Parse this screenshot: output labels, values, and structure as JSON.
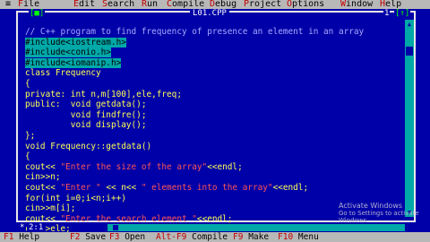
{
  "menu": {
    "system": "≡",
    "items": [
      {
        "label": "File",
        "hotkey": "F",
        "rest": "ile"
      },
      {
        "label": "Edit",
        "hotkey": "E",
        "rest": "dit"
      },
      {
        "label": "Search",
        "hotkey": "S",
        "rest": "earch"
      },
      {
        "label": "Run",
        "hotkey": "R",
        "rest": "un"
      },
      {
        "label": "Compile",
        "hotkey": "C",
        "rest": "ompile"
      },
      {
        "label": "Debug",
        "hotkey": "D",
        "rest": "ebug"
      },
      {
        "label": "Project",
        "hotkey": "P",
        "rest": "roject"
      },
      {
        "label": "Options",
        "hotkey": "O",
        "rest": "ptions"
      },
      {
        "label": "Window",
        "hotkey": "W",
        "rest": "indow"
      },
      {
        "label": "Help",
        "hotkey": "H",
        "rest": "elp"
      }
    ]
  },
  "window": {
    "title": "L01.CPP",
    "close_btn": "[■]",
    "number": "1",
    "zoom_btn": "[↑]"
  },
  "code_lines": [
    {
      "segments": [
        {
          "text": "// C++ program to find frequency of presence an element in an array",
          "cls": "cmt"
        }
      ]
    },
    {
      "segments": [
        {
          "text": "#include<iostream.h>",
          "cls": "hl"
        }
      ]
    },
    {
      "segments": [
        {
          "text": "#include<conio.h>",
          "cls": "hl"
        }
      ]
    },
    {
      "segments": [
        {
          "text": "#include<iomanip.h>",
          "cls": "hl"
        }
      ]
    },
    {
      "segments": [
        {
          "text": "class Frequency",
          "cls": ""
        }
      ]
    },
    {
      "segments": [
        {
          "text": "{",
          "cls": ""
        }
      ]
    },
    {
      "segments": [
        {
          "text": "private: int n,m[100],ele,freq;",
          "cls": ""
        }
      ]
    },
    {
      "segments": [
        {
          "text": "public:  void getdata();",
          "cls": ""
        }
      ]
    },
    {
      "segments": [
        {
          "text": "         void findfre();",
          "cls": ""
        }
      ]
    },
    {
      "segments": [
        {
          "text": "         void display();",
          "cls": ""
        }
      ]
    },
    {
      "segments": [
        {
          "text": "};",
          "cls": ""
        }
      ]
    },
    {
      "segments": [
        {
          "text": "void Frequency::getdata()",
          "cls": ""
        }
      ]
    },
    {
      "segments": [
        {
          "text": "{",
          "cls": ""
        }
      ]
    },
    {
      "segments": [
        {
          "text": "cout<< ",
          "cls": ""
        },
        {
          "text": "\"Enter the size of the array\"",
          "cls": "str"
        },
        {
          "text": "<<endl;",
          "cls": ""
        }
      ]
    },
    {
      "segments": [
        {
          "text": "cin>>n;",
          "cls": ""
        }
      ]
    },
    {
      "segments": [
        {
          "text": "cout<< ",
          "cls": ""
        },
        {
          "text": "\"Enter \"",
          "cls": "str"
        },
        {
          "text": " << n<< ",
          "cls": ""
        },
        {
          "text": "\" elements into the array\"",
          "cls": "str"
        },
        {
          "text": "<<endl;",
          "cls": ""
        }
      ]
    },
    {
      "segments": [
        {
          "text": "for(int i=0;i<n;i++)",
          "cls": ""
        }
      ]
    },
    {
      "segments": [
        {
          "text": "cin>>m[i];",
          "cls": ""
        }
      ]
    },
    {
      "segments": [
        {
          "text": "cout<< ",
          "cls": ""
        },
        {
          "text": "\"Enter the search element \"",
          "cls": "str"
        },
        {
          "text": "<<endl;",
          "cls": ""
        }
      ]
    },
    {
      "segments": [
        {
          "text": "cin>>ele;",
          "cls": ""
        }
      ]
    }
  ],
  "status": {
    "modified": "*",
    "position": "2:1"
  },
  "watermark": {
    "line1": "Activate Windows",
    "line2": "Go to Settings to activate Windows."
  },
  "fkeys": [
    {
      "key": "F1",
      "label": "Help"
    },
    {
      "key": "F2",
      "label": "Save"
    },
    {
      "key": "F3",
      "label": "Open"
    },
    {
      "key": "Alt-F9",
      "label": "Compile"
    },
    {
      "key": "F9",
      "label": "Make"
    },
    {
      "key": "F10",
      "label": "Menu"
    }
  ],
  "colors": {
    "editor_bg": "#0000A8",
    "code_text": "#FFFF55",
    "comment": "#A8A8FF",
    "string": "#FF5555",
    "selection": "#00A8A8",
    "menu_bg": "#B8B8B8",
    "hotkey": "#C00000"
  }
}
